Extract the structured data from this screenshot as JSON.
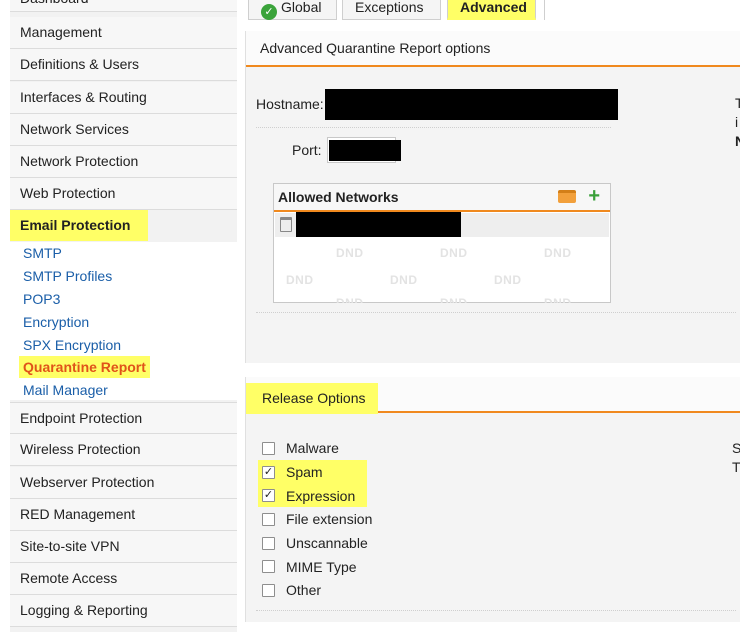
{
  "sidebar": {
    "top_items": [
      {
        "label": "Dashboard"
      },
      {
        "label": "Management"
      },
      {
        "label": "Definitions & Users"
      },
      {
        "label": "Interfaces & Routing"
      },
      {
        "label": "Network Services"
      },
      {
        "label": "Network Protection"
      },
      {
        "label": "Web Protection"
      },
      {
        "label": "Email Protection"
      }
    ],
    "sub_items": [
      {
        "label": "SMTP"
      },
      {
        "label": "SMTP Profiles"
      },
      {
        "label": "POP3"
      },
      {
        "label": "Encryption"
      },
      {
        "label": "SPX Encryption"
      },
      {
        "label": "Quarantine Report"
      },
      {
        "label": "Mail Manager"
      }
    ],
    "bottom_items": [
      {
        "label": "Endpoint Protection"
      },
      {
        "label": "Wireless Protection"
      },
      {
        "label": "Webserver Protection"
      },
      {
        "label": "RED Management"
      },
      {
        "label": "Site-to-site VPN"
      },
      {
        "label": "Remote Access"
      },
      {
        "label": "Logging & Reporting"
      }
    ]
  },
  "tabs": [
    {
      "label": "Global"
    },
    {
      "label": "Exceptions"
    },
    {
      "label": "Advanced"
    }
  ],
  "advanced_panel": {
    "title": "Advanced Quarantine Report options",
    "hostname_label": "Hostname:",
    "port_label": "Port:",
    "allowed_networks": {
      "title": "Allowed Networks",
      "watermark": "DND"
    },
    "side_text": [
      "T",
      "i",
      "N"
    ]
  },
  "release_panel": {
    "title": "Release Options",
    "options": [
      {
        "label": "Malware",
        "checked": false
      },
      {
        "label": "Spam",
        "checked": true
      },
      {
        "label": "Expression",
        "checked": true
      },
      {
        "label": "File extension",
        "checked": false
      },
      {
        "label": "Unscannable",
        "checked": false
      },
      {
        "label": "MIME Type",
        "checked": false
      },
      {
        "label": "Other",
        "checked": false
      }
    ],
    "side_text": [
      "S",
      "T"
    ]
  },
  "colors": {
    "accent_orange": "#f0891e",
    "highlight_yellow": "#ffff66",
    "link_blue": "#1a5ea8",
    "active_orange": "#e0531a"
  },
  "icons": {
    "global_tab": "check-circle-icon",
    "add": "plus-icon",
    "folder": "folder-icon",
    "delete": "trash-icon"
  }
}
